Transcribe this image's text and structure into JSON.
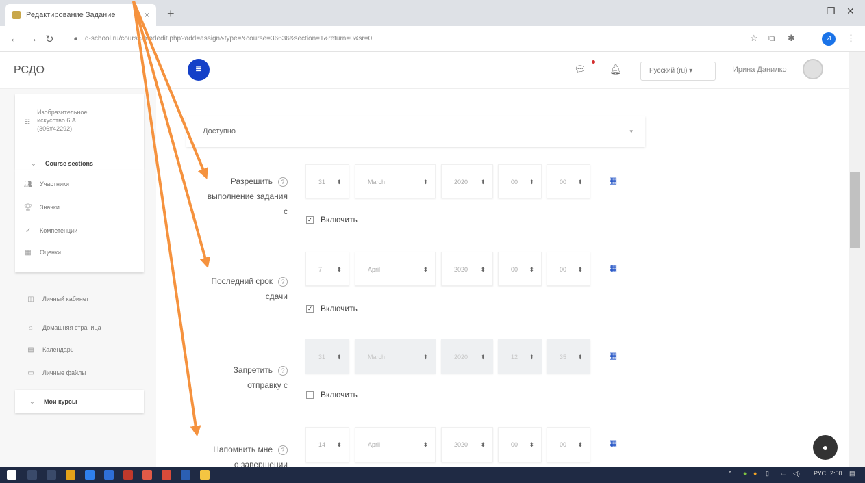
{
  "browser": {
    "tab_title": "Редактирование Задание",
    "url": "d-school.ru/course/modedit.php?add=assign&type=&course=36636&section=1&return=0&sr=0",
    "profile_initial": "И"
  },
  "header": {
    "brand": "РСДО",
    "language": "Русский (ru)",
    "user_name": "Ирина Данилко"
  },
  "sidebar": {
    "course_name": [
      "Изобразительное",
      "искусство 6 А",
      "(306#42292)"
    ],
    "course_sections": "Course sections",
    "nav_items": [
      {
        "label": "Участники",
        "icon": "users-icon"
      },
      {
        "label": "Значки",
        "icon": "trophy-icon"
      },
      {
        "label": "Компетенции",
        "icon": "check-icon"
      },
      {
        "label": "Оценки",
        "icon": "grid-icon"
      }
    ],
    "links": [
      {
        "label": "Личный кабинет",
        "icon": "dashboard-icon"
      },
      {
        "label": "Домашняя страница",
        "icon": "home-icon"
      },
      {
        "label": "Календарь",
        "icon": "calendar-icon"
      },
      {
        "label": "Личные файлы",
        "icon": "folder-icon"
      }
    ],
    "my_courses": "Мои курсы"
  },
  "form": {
    "availability_value": "Доступно",
    "enable_label": "Включить",
    "rows": [
      {
        "label": [
          "Разрешить",
          "выполнение задания",
          "с"
        ],
        "day": "31",
        "month": "March",
        "year": "2020",
        "hour": "00",
        "minute": "00",
        "checked": true
      },
      {
        "label": [
          "Последний срок",
          "сдачи"
        ],
        "day": "7",
        "month": "April",
        "year": "2020",
        "hour": "00",
        "minute": "00",
        "checked": true
      },
      {
        "label": [
          "Запретить",
          "отправку с"
        ],
        "day": "31",
        "month": "March",
        "year": "2020",
        "hour": "12",
        "minute": "35",
        "checked": false
      },
      {
        "label": [
          "Напомнить мне",
          "о завершении"
        ],
        "day": "14",
        "month": "April",
        "year": "2020",
        "hour": "00",
        "minute": "00",
        "checked": true
      }
    ]
  },
  "taskbar": {
    "lang": "РУС",
    "time": "2:50"
  },
  "colors": {
    "accent": "#1440c8",
    "arrow": "#f5923e",
    "calendar": "#1d4fc4"
  }
}
